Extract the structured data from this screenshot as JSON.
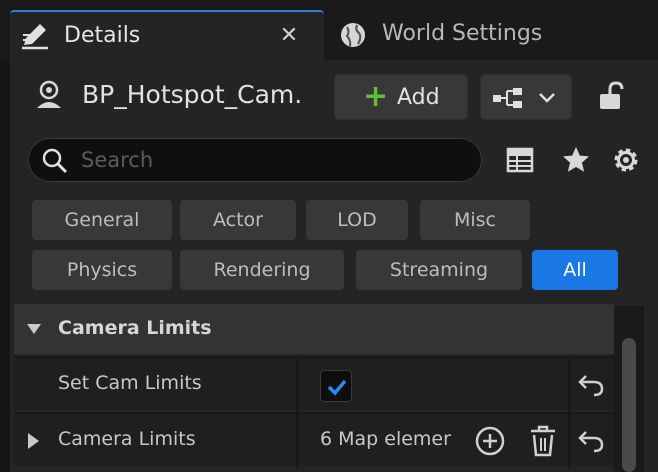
{
  "tabs": {
    "details": {
      "label": "Details",
      "close": "✕"
    },
    "world_settings": {
      "label": "World Settings"
    }
  },
  "header": {
    "actor_name": "BP_Hotspot_Cam.",
    "add_label": "Add",
    "add_symbol": "+"
  },
  "search": {
    "placeholder": "Search",
    "value": ""
  },
  "toolbar_icons": [
    "table-view-icon",
    "favorites-star-icon",
    "settings-gear-icon"
  ],
  "filters": {
    "row1": [
      "General",
      "Actor",
      "LOD",
      "Misc"
    ],
    "row2": [
      "Physics",
      "Rendering",
      "Streaming",
      "All"
    ],
    "active": "All"
  },
  "category": {
    "label": "Camera Limits",
    "expanded": true
  },
  "properties": [
    {
      "name": "Set Cam Limits",
      "type": "checkbox",
      "checked": true
    },
    {
      "name": "Camera Limits",
      "type": "map",
      "value": "6 Map elemer"
    }
  ],
  "colors": {
    "accent": "#1a78e6",
    "add_plus": "#5fbf3a",
    "panel": "#242424",
    "background": "#151515"
  }
}
